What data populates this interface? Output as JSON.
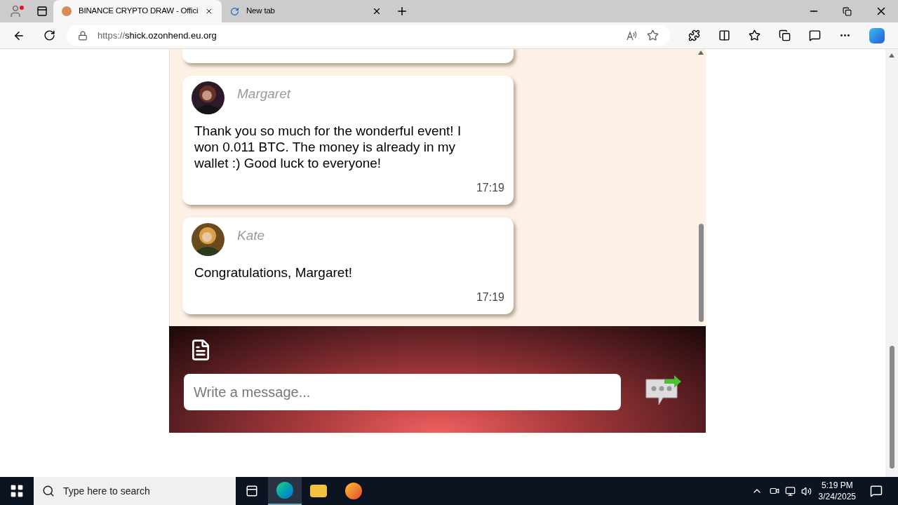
{
  "browser": {
    "tabs": [
      {
        "title": "BINANCE CRYPTO DRAW - Offici",
        "selected": true,
        "kind": "site"
      },
      {
        "title": "New tab",
        "selected": false,
        "kind": "loading"
      }
    ],
    "url_scheme": "https://",
    "url_host": "shick.ozonhend.eu.org"
  },
  "chat": {
    "messages": [
      {
        "author": "Margaret",
        "text": "Thank you so much for the wonderful event! I won 0.011 BTC. The money is already in my wallet :) Good luck to everyone!",
        "time": "17:19"
      },
      {
        "author": "Kate",
        "text": "Congratulations, Margaret!",
        "time": "17:19"
      }
    ],
    "composer": {
      "placeholder": "Write a message..."
    }
  },
  "taskbar": {
    "search_placeholder": "Type here to search",
    "time": "5:19 PM",
    "date": "3/24/2025"
  }
}
